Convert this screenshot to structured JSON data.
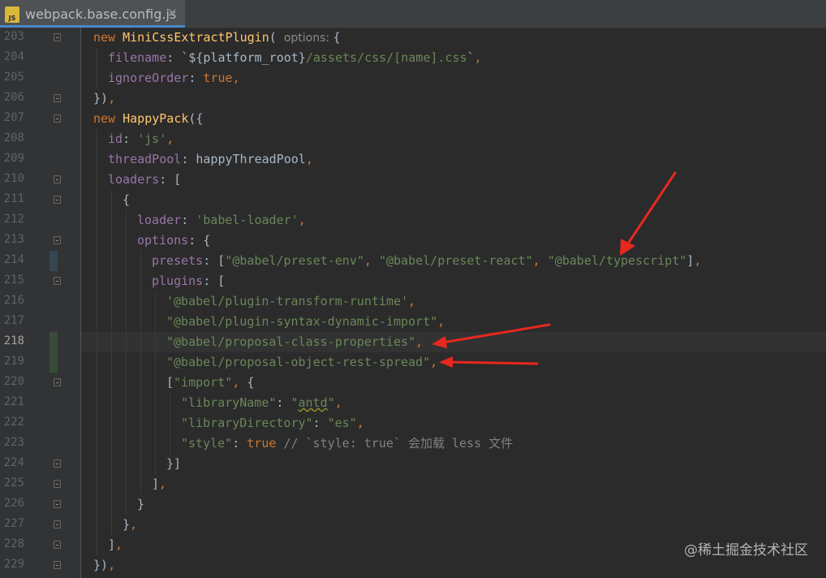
{
  "tab": {
    "icon_label": "JS",
    "filename": "webpack.base.config.js",
    "close": "✕"
  },
  "colors": {
    "keyword": "#cc7832",
    "string": "#6a8759",
    "property": "#9876aa",
    "class": "#ffc66d",
    "default": "#a9b7c6",
    "comment": "#808080",
    "annotation_arrow": "#e8281e"
  },
  "current_line": 218,
  "lines": [
    {
      "n": "203",
      "indent": 2,
      "fold": true,
      "mark": "",
      "tokens": [
        [
          "kw",
          "new "
        ],
        [
          "cls",
          "MiniCssExtractPlugin"
        ],
        [
          "default",
          "( "
        ],
        [
          "hint",
          "options: "
        ],
        [
          "default",
          "{"
        ]
      ]
    },
    {
      "n": "204",
      "indent": 3,
      "fold": false,
      "mark": "",
      "tokens": [
        [
          "prop",
          "filename"
        ],
        [
          "default",
          ": `${platform_root}"
        ],
        [
          "str",
          "/assets/css/[name].css"
        ],
        [
          "default",
          "`"
        ],
        [
          "kw",
          ","
        ]
      ]
    },
    {
      "n": "205",
      "indent": 3,
      "fold": false,
      "mark": "",
      "tokens": [
        [
          "prop",
          "ignoreOrder"
        ],
        [
          "default",
          ": "
        ],
        [
          "kw",
          "true,"
        ]
      ]
    },
    {
      "n": "206",
      "indent": 2,
      "fold": true,
      "mark": "",
      "tokens": [
        [
          "default",
          "})"
        ],
        [
          "kw",
          ","
        ]
      ]
    },
    {
      "n": "207",
      "indent": 2,
      "fold": true,
      "mark": "",
      "tokens": [
        [
          "kw",
          "new "
        ],
        [
          "cls",
          "HappyPack"
        ],
        [
          "default",
          "({"
        ]
      ]
    },
    {
      "n": "208",
      "indent": 3,
      "fold": false,
      "mark": "",
      "tokens": [
        [
          "prop",
          "id"
        ],
        [
          "default",
          ": "
        ],
        [
          "str",
          "'js'"
        ],
        [
          "kw",
          ","
        ]
      ]
    },
    {
      "n": "209",
      "indent": 3,
      "fold": false,
      "mark": "",
      "tokens": [
        [
          "prop",
          "threadPool"
        ],
        [
          "default",
          ": happyThreadPool"
        ],
        [
          "kw",
          ","
        ]
      ]
    },
    {
      "n": "210",
      "indent": 3,
      "fold": true,
      "mark": "",
      "tokens": [
        [
          "prop",
          "loaders"
        ],
        [
          "default",
          ": ["
        ]
      ]
    },
    {
      "n": "211",
      "indent": 4,
      "fold": true,
      "mark": "",
      "tokens": [
        [
          "default",
          "{"
        ]
      ]
    },
    {
      "n": "212",
      "indent": 5,
      "fold": false,
      "mark": "",
      "tokens": [
        [
          "prop",
          "loader"
        ],
        [
          "default",
          ": "
        ],
        [
          "str",
          "'babel-loader'"
        ],
        [
          "kw",
          ","
        ]
      ]
    },
    {
      "n": "213",
      "indent": 5,
      "fold": true,
      "mark": "",
      "tokens": [
        [
          "prop",
          "options"
        ],
        [
          "default",
          ": {"
        ]
      ]
    },
    {
      "n": "214",
      "indent": 6,
      "fold": false,
      "mark": "modified",
      "tokens": [
        [
          "prop",
          "presets"
        ],
        [
          "default",
          ": ["
        ],
        [
          "str",
          "\"@babel/preset-env\""
        ],
        [
          "kw",
          ", "
        ],
        [
          "str",
          "\"@babel/preset-react\""
        ],
        [
          "kw",
          ", "
        ],
        [
          "str",
          "\"@babel/typescript\""
        ],
        [
          "default",
          "]"
        ],
        [
          "kw",
          ","
        ]
      ]
    },
    {
      "n": "215",
      "indent": 6,
      "fold": true,
      "mark": "",
      "tokens": [
        [
          "prop",
          "plugins"
        ],
        [
          "default",
          ": ["
        ]
      ]
    },
    {
      "n": "216",
      "indent": 7,
      "fold": false,
      "mark": "",
      "tokens": [
        [
          "str",
          "'@babel/plugin-transform-runtime'"
        ],
        [
          "kw",
          ","
        ]
      ]
    },
    {
      "n": "217",
      "indent": 7,
      "fold": false,
      "mark": "",
      "tokens": [
        [
          "str",
          "\"@babel/plugin-syntax-dynamic-import\""
        ],
        [
          "kw",
          ","
        ]
      ]
    },
    {
      "n": "218",
      "indent": 7,
      "fold": false,
      "mark": "added",
      "tokens": [
        [
          "str",
          "\"@babel/proposal-class-properties\""
        ],
        [
          "kw",
          ","
        ]
      ]
    },
    {
      "n": "219",
      "indent": 7,
      "fold": false,
      "mark": "added",
      "tokens": [
        [
          "str",
          "\"@babel/proposal-object-rest-spread\""
        ],
        [
          "kw",
          ","
        ]
      ]
    },
    {
      "n": "220",
      "indent": 7,
      "fold": true,
      "mark": "",
      "tokens": [
        [
          "default",
          "["
        ],
        [
          "str",
          "\"import\""
        ],
        [
          "kw",
          ", "
        ],
        [
          "default",
          "{"
        ]
      ]
    },
    {
      "n": "221",
      "indent": 8,
      "fold": false,
      "mark": "",
      "tokens": [
        [
          "str",
          "\"libraryName\""
        ],
        [
          "default",
          ": "
        ],
        [
          "str",
          "\""
        ],
        [
          "err",
          "antd"
        ],
        [
          "str",
          "\""
        ],
        [
          "kw",
          ","
        ]
      ]
    },
    {
      "n": "222",
      "indent": 8,
      "fold": false,
      "mark": "",
      "tokens": [
        [
          "str",
          "\"libraryDirectory\""
        ],
        [
          "default",
          ": "
        ],
        [
          "str",
          "\"es\""
        ],
        [
          "kw",
          ","
        ]
      ]
    },
    {
      "n": "223",
      "indent": 8,
      "fold": false,
      "mark": "",
      "tokens": [
        [
          "str",
          "\"style\""
        ],
        [
          "default",
          ": "
        ],
        [
          "kw",
          "true "
        ],
        [
          "cmt",
          "// `style: true` 会加载 less 文件"
        ]
      ]
    },
    {
      "n": "224",
      "indent": 7,
      "fold": true,
      "mark": "",
      "tokens": [
        [
          "default",
          "}]"
        ]
      ]
    },
    {
      "n": "225",
      "indent": 6,
      "fold": true,
      "mark": "",
      "tokens": [
        [
          "default",
          "]"
        ],
        [
          "kw",
          ","
        ]
      ]
    },
    {
      "n": "226",
      "indent": 5,
      "fold": true,
      "mark": "",
      "tokens": [
        [
          "default",
          "}"
        ]
      ]
    },
    {
      "n": "227",
      "indent": 4,
      "fold": true,
      "mark": "",
      "tokens": [
        [
          "default",
          "}"
        ],
        [
          "kw",
          ","
        ]
      ]
    },
    {
      "n": "228",
      "indent": 3,
      "fold": true,
      "mark": "",
      "tokens": [
        [
          "default",
          "]"
        ],
        [
          "kw",
          ","
        ]
      ]
    },
    {
      "n": "229",
      "indent": 2,
      "fold": true,
      "mark": "",
      "tokens": [
        [
          "default",
          "})"
        ],
        [
          "kw",
          ","
        ]
      ]
    }
  ],
  "watermark": "@稀土掘金技术社区"
}
